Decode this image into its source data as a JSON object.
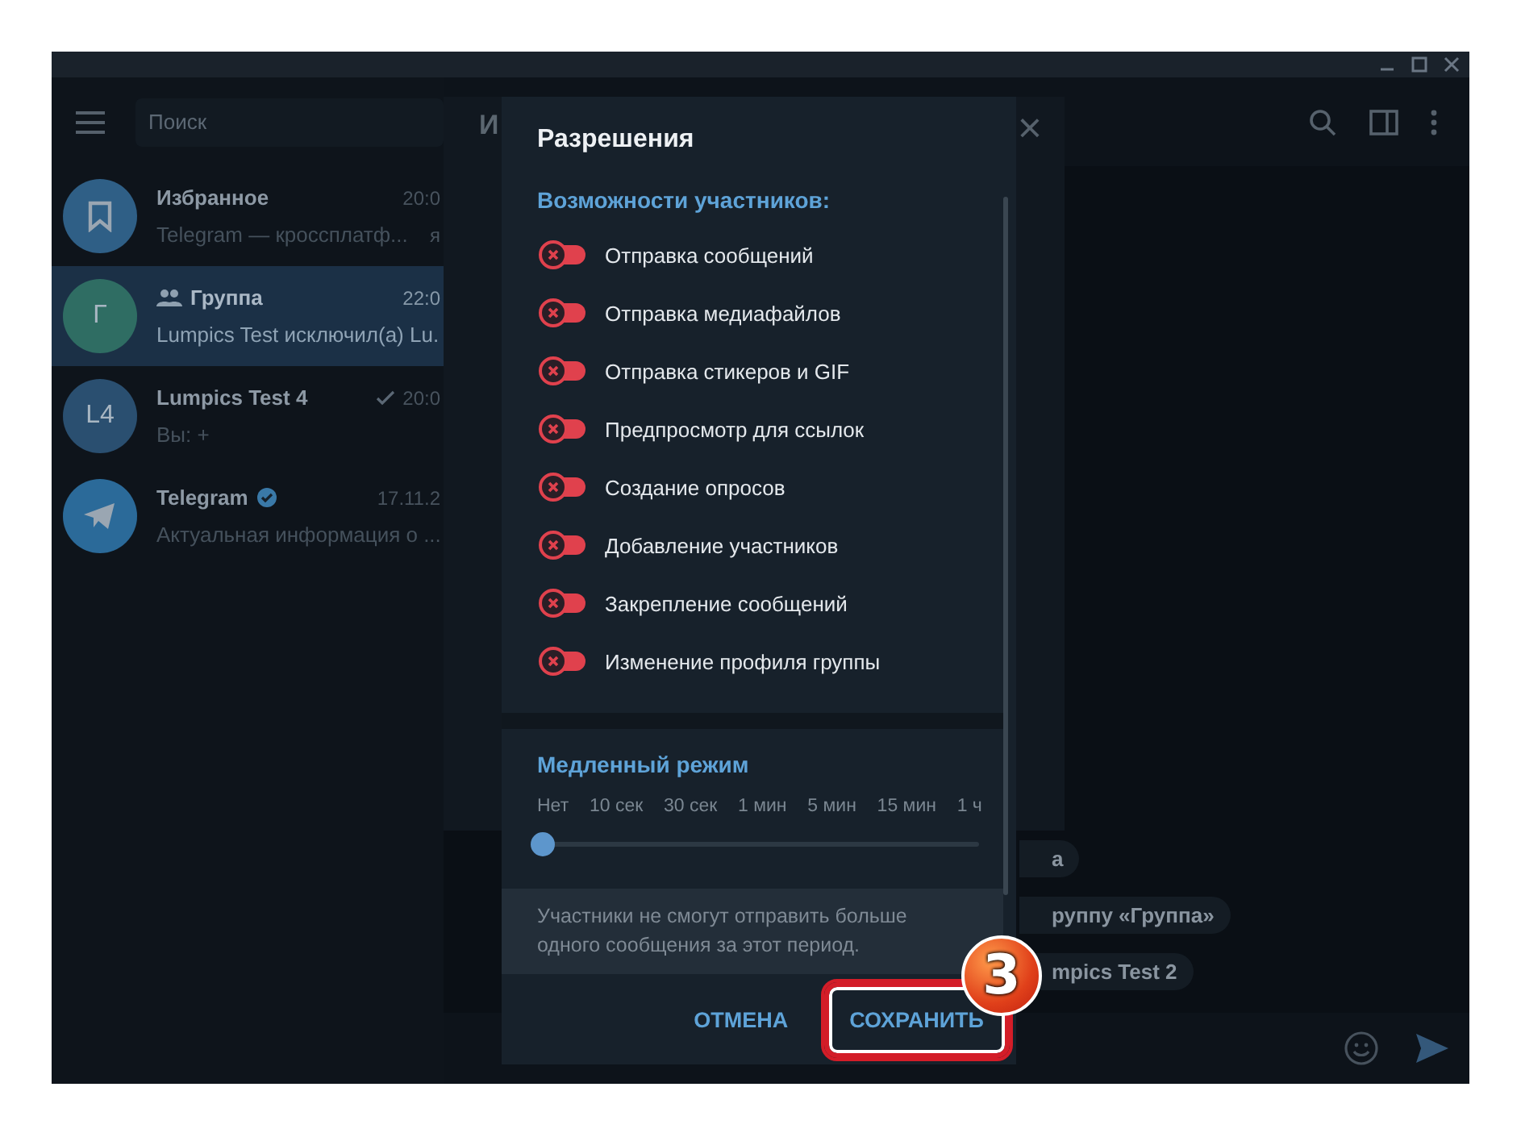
{
  "sidebar": {
    "search": {
      "placeholder": "Поиск"
    },
    "chats": [
      {
        "name": "Избранное",
        "time": "20:0",
        "preview": "Telegram — кроссплатф...",
        "extra": "я",
        "avatar": {
          "kind": "saved",
          "color": "#2f5f86"
        },
        "is_group": false,
        "verified": false,
        "read": false,
        "selected": false
      },
      {
        "name": "Группа",
        "time": "22:0",
        "preview": "Lumpics Test исключил(а) Lu.",
        "avatar": {
          "kind": "initials",
          "text": "Г",
          "color": "#2f6d63"
        },
        "is_group": true,
        "verified": false,
        "read": false,
        "selected": true
      },
      {
        "name": "Lumpics Test 4",
        "time": "20:0",
        "preview": "Вы: +",
        "avatar": {
          "kind": "initials",
          "text": "L4",
          "color": "#2a4f70"
        },
        "is_group": false,
        "verified": false,
        "read": true,
        "selected": false
      },
      {
        "name": "Telegram",
        "time": "17.11.2",
        "preview": "Актуальная информация о ...",
        "avatar": {
          "kind": "telegram",
          "color": "#2b6a99"
        },
        "is_group": false,
        "verified": true,
        "read": false,
        "selected": false
      }
    ]
  },
  "group_panel": {
    "title": "И",
    "close": "×"
  },
  "messages": [
    "а",
    "руппу «Группа»",
    "mpics Test 2"
  ],
  "dialog": {
    "title": "Разрешения",
    "section": "Возможности участников:",
    "permissions": [
      {
        "label": "Отправка сообщений",
        "on": false
      },
      {
        "label": "Отправка медиафайлов",
        "on": false
      },
      {
        "label": "Отправка стикеров и GIF",
        "on": false
      },
      {
        "label": "Предпросмотр для ссылок",
        "on": false
      },
      {
        "label": "Создание опросов",
        "on": false
      },
      {
        "label": "Добавление участников",
        "on": false
      },
      {
        "label": "Закрепление сообщений",
        "on": false
      },
      {
        "label": "Изменение профиля группы",
        "on": false
      }
    ],
    "slow_mode": {
      "title": "Медленный режим",
      "options": [
        "Нет",
        "10 сек",
        "30 сек",
        "1 мин",
        "5 мин",
        "15 мин",
        "1 ч"
      ],
      "level": 0,
      "note": "Участники не смогут отправить больше одного сообщения за этот период."
    },
    "buttons": [
      {
        "label": "ОТМЕНА",
        "highlighted": false
      },
      {
        "label": "СОХРАНИТЬ",
        "highlighted": true
      }
    ]
  },
  "annotation": {
    "marker": "3"
  }
}
